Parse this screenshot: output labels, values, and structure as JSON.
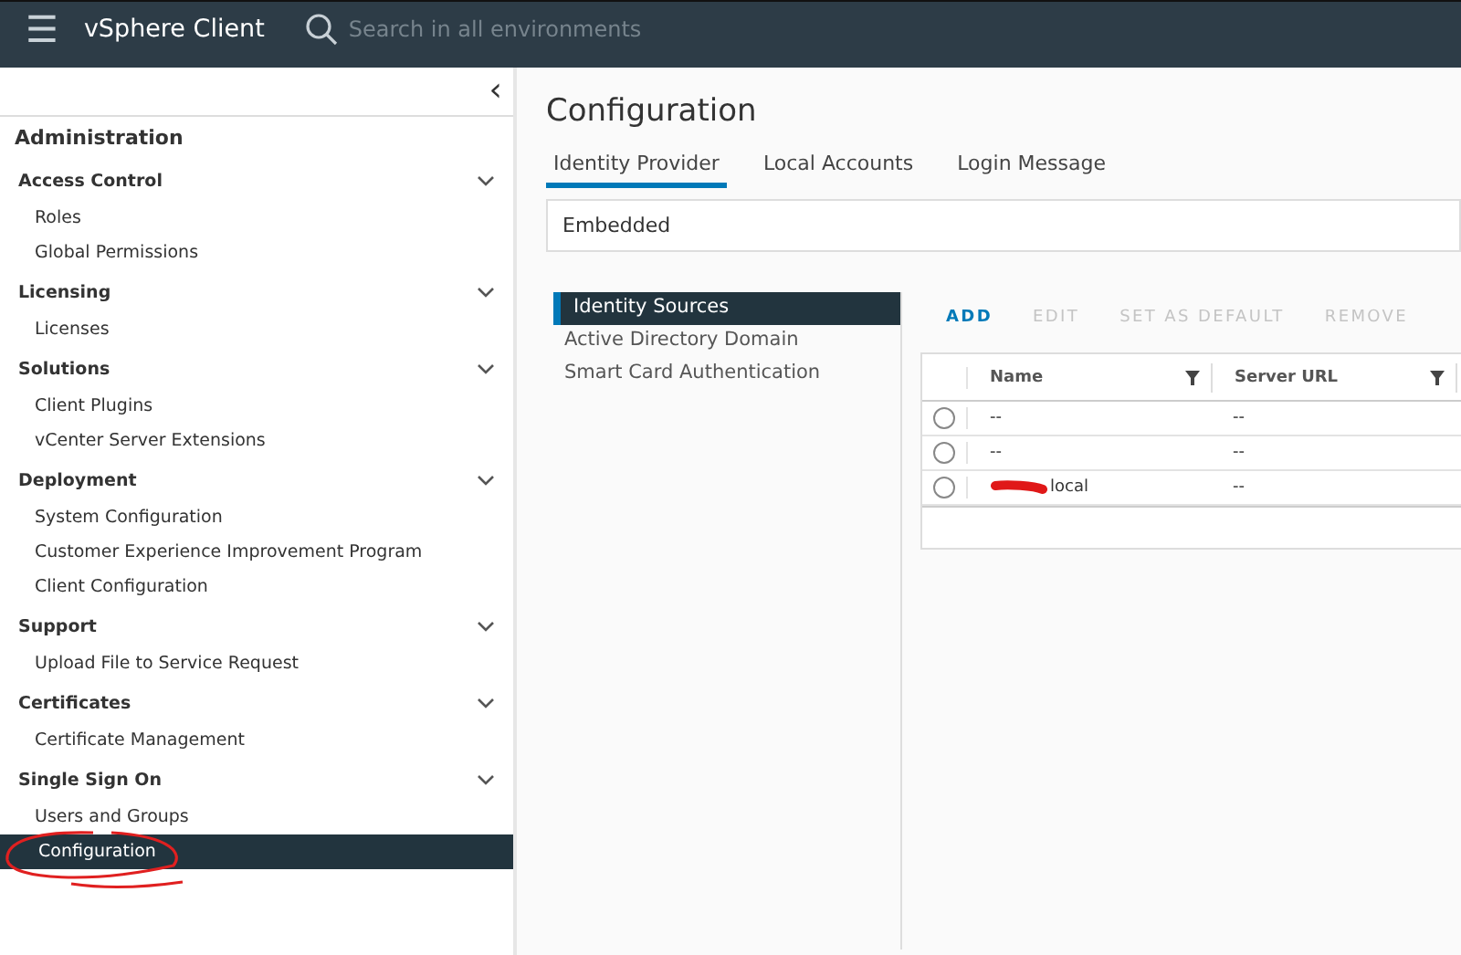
{
  "header": {
    "menu_icon": "☰",
    "app_title": "vSphere Client",
    "search_placeholder": "Search in all environments"
  },
  "sidebar": {
    "collapse": "‹",
    "title": "Administration",
    "sections": [
      {
        "label": "Access Control",
        "expanded": true,
        "items": [
          {
            "label": "Roles",
            "selected": false
          },
          {
            "label": "Global Permissions",
            "selected": false
          }
        ]
      },
      {
        "label": "Licensing",
        "expanded": true,
        "items": [
          {
            "label": "Licenses",
            "selected": false
          }
        ]
      },
      {
        "label": "Solutions",
        "expanded": true,
        "items": [
          {
            "label": "Client Plugins",
            "selected": false
          },
          {
            "label": "vCenter Server Extensions",
            "selected": false
          }
        ]
      },
      {
        "label": "Deployment",
        "expanded": true,
        "items": [
          {
            "label": "System Configuration",
            "selected": false
          },
          {
            "label": "Customer Experience Improvement Program",
            "selected": false
          },
          {
            "label": "Client Configuration",
            "selected": false
          }
        ]
      },
      {
        "label": "Support",
        "expanded": true,
        "items": [
          {
            "label": "Upload File to Service Request",
            "selected": false
          }
        ]
      },
      {
        "label": "Certificates",
        "expanded": true,
        "items": [
          {
            "label": "Certificate Management",
            "selected": false
          }
        ]
      },
      {
        "label": "Single Sign On",
        "expanded": true,
        "items": [
          {
            "label": "Users and Groups",
            "selected": false
          },
          {
            "label": "Configuration",
            "selected": true
          }
        ]
      }
    ]
  },
  "page": {
    "title": "Configuration",
    "tabs": [
      {
        "label": "Identity Provider",
        "selected": true
      },
      {
        "label": "Local Accounts",
        "selected": false
      },
      {
        "label": "Login Message",
        "selected": false
      }
    ],
    "provider": "Embedded",
    "nav": [
      {
        "label": "Identity Sources",
        "selected": true
      },
      {
        "label": "Active Directory Domain",
        "selected": false
      },
      {
        "label": "Smart Card Authentication",
        "selected": false
      }
    ],
    "actions": [
      {
        "label": "ADD",
        "disabled": false
      },
      {
        "label": "EDIT",
        "disabled": true
      },
      {
        "label": "SET AS DEFAULT",
        "disabled": true
      },
      {
        "label": "REMOVE",
        "disabled": true
      }
    ],
    "table": {
      "columns": [
        "Name",
        "Server URL"
      ],
      "rows": [
        {
          "name": "--",
          "url": "--",
          "selected": false,
          "redacted": false
        },
        {
          "name": "--",
          "url": "--",
          "selected": false,
          "redacted": false
        },
        {
          "name": "local",
          "url": "--",
          "selected": false,
          "redacted": true
        }
      ]
    }
  }
}
